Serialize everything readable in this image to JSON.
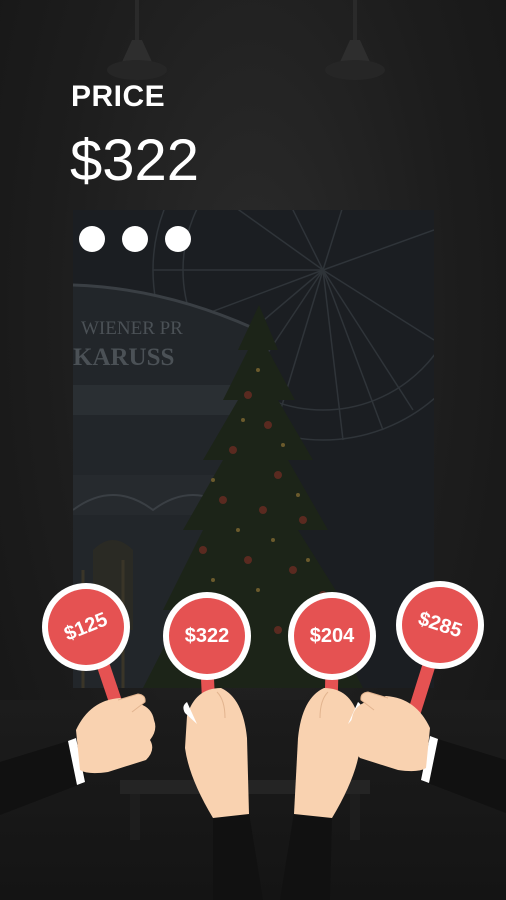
{
  "header": {
    "label": "PRICE",
    "value": "$322"
  },
  "slides": {
    "count": 3,
    "active_color": "#ffffff"
  },
  "painting": {
    "subject": "christmas-tree-carousel-photo",
    "sign_line1": "WIENER PR",
    "sign_line2": "KARUSS"
  },
  "bids": [
    {
      "label": "$125"
    },
    {
      "label": "$322"
    },
    {
      "label": "$204"
    },
    {
      "label": "$285"
    }
  ],
  "colors": {
    "paddle": "#e55252",
    "paddle_border": "#ffffff",
    "skin": "#f9d2b0",
    "sleeve": "#111111"
  }
}
